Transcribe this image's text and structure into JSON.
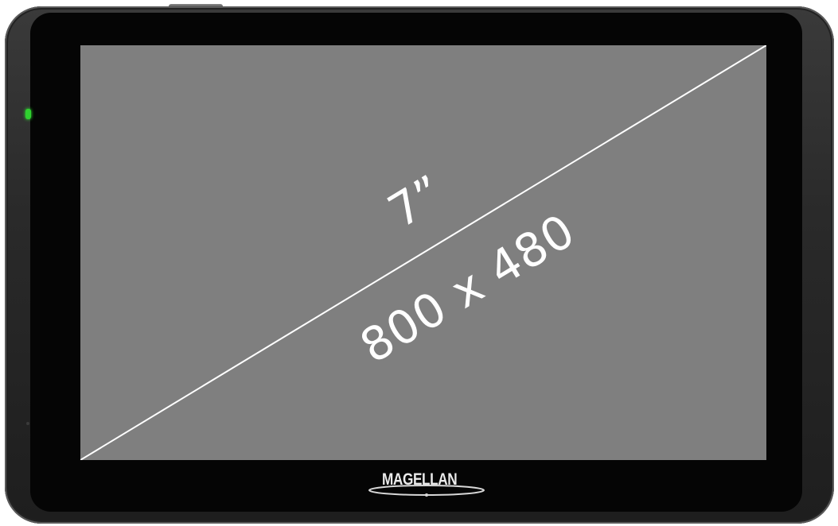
{
  "screen": {
    "size_label": "7”",
    "resolution_label": "800 x 480"
  },
  "brand": {
    "name": "MAGELLAN",
    "trademark": "®"
  },
  "indicators": {
    "power_led_color": "#2fd12f",
    "screen_color": "#7f7f7f"
  }
}
